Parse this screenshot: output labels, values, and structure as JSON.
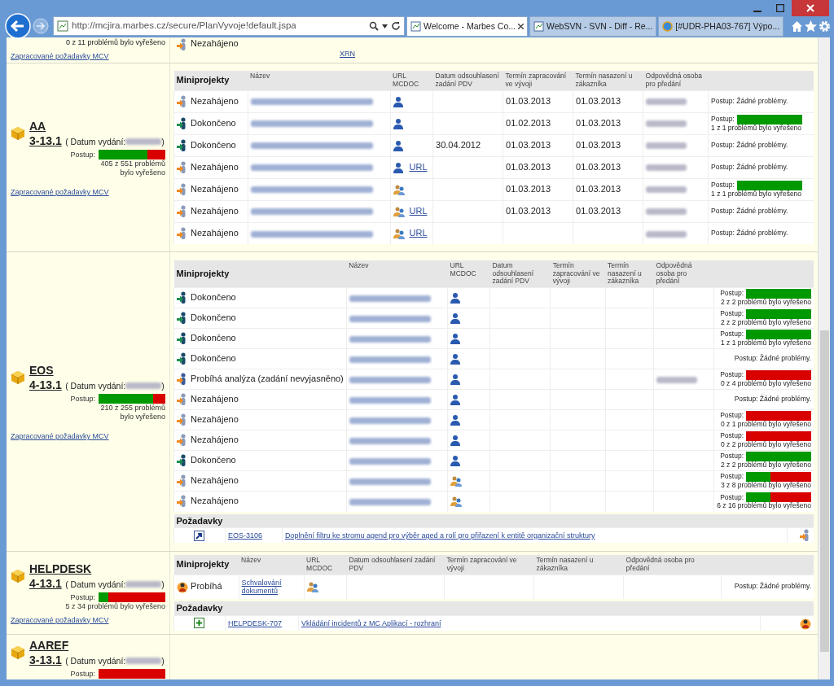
{
  "browser": {
    "address": "http://mcjira.marbes.cz/secure/PlanVyvoje!default.jspa",
    "tabs": [
      {
        "label": "Welcome - Marbes Co...",
        "selected": true
      },
      {
        "label": "WebSVN - SVN - Diff - Re...",
        "selected": false
      },
      {
        "label": "[#UDR-PHA03-767] Výpo...",
        "selected": false
      }
    ]
  },
  "top_stub": {
    "progress_text": "0 z 11 problémů bylo vyřešeno",
    "link": "Zapracované požadavky MCV",
    "status": "Nezahájeno",
    "kind": "not_started",
    "url": "XRN"
  },
  "releases": [
    {
      "name": "AA",
      "version": "3-13.1",
      "date_label": "( Datum vydání:",
      "date_close": ")",
      "progress_label": "Postup:",
      "level": 0.735,
      "progress_text": "405 z 551 problémů bylo vyřešeno",
      "link": "Zapracované požadavky MCV",
      "table_title": "Miniprojekty",
      "columns": [
        "Název",
        "URL MCDOC",
        "Datum odsouhlasení zadání PDV",
        "Termín zapracování ve vývoji",
        "Termín nasazení u zákazníka",
        "Odpovědná osoba pro předání"
      ],
      "rows": [
        {
          "status": "Nezahájeno",
          "kind": "not_started",
          "url_icon": {
            "kind": "person"
          },
          "datum": "",
          "termin_vyvoj": "01.03.2013",
          "termin_nasazeni": "01.03.2013",
          "person_redacted": true,
          "progress_label": "Postup:",
          "progress_text": "Žádné problémy."
        },
        {
          "status": "Dokončeno",
          "kind": "done",
          "url_icon": {
            "kind": "person"
          },
          "datum": "",
          "termin_vyvoj": "01.02.2013",
          "termin_nasazeni": "01.03.2013",
          "person_redacted": true,
          "progress_label": "Postup:",
          "level": 1,
          "progress_text": "1 z 1 problémů bylo vyřešeno"
        },
        {
          "status": "Dokončeno",
          "kind": "done",
          "url_icon": {
            "kind": "person"
          },
          "datum": "30.04.2012",
          "termin_vyvoj": "01.03.2013",
          "termin_nasazeni": "01.03.2013",
          "person_redacted": true,
          "progress_label": "Postup:",
          "progress_text": "Žádné problémy."
        },
        {
          "status": "Nezahájeno",
          "kind": "not_started",
          "url_icon": {
            "kind": "person"
          },
          "url": "URL",
          "datum": "",
          "termin_vyvoj": "01.03.2013",
          "termin_nasazeni": "01.03.2013",
          "person_redacted": true,
          "progress_label": "Postup:",
          "progress_text": "Žádné problémy."
        },
        {
          "status": "Nezahájeno",
          "kind": "not_started",
          "url_icon": {
            "kind": "group"
          },
          "datum": "",
          "termin_vyvoj": "01.03.2013",
          "termin_nasazeni": "01.03.2013",
          "person_redacted": true,
          "progress_label": "Postup:",
          "level": 1,
          "progress_text": "1 z 1 problémů bylo vyřešeno"
        },
        {
          "status": "Nezahájeno",
          "kind": "not_started",
          "url_icon": {
            "kind": "group"
          },
          "url": "URL",
          "datum": "",
          "termin_vyvoj": "01.03.2013",
          "termin_nasazeni": "01.03.2013",
          "person_redacted": true,
          "progress_label": "Postup:",
          "progress_text": "Žádné problémy."
        },
        {
          "status": "Nezahájeno",
          "kind": "not_started",
          "url_icon": {
            "kind": "group"
          },
          "url": "URL",
          "datum": "",
          "termin_vyvoj": "",
          "termin_nasazeni": "",
          "person_redacted": true,
          "progress_label": "Postup:",
          "progress_text": "Žádné problémy."
        }
      ]
    },
    {
      "name": "EOS",
      "version": "4-13.1",
      "date_label": "( Datum vydání:",
      "date_close": ")",
      "progress_label": "Postup:",
      "level": 0.82,
      "progress_text": "210 z 255 problémů bylo vyřešeno",
      "link": "Zapracované požadavky MCV",
      "table_title": "Miniprojekty",
      "columns": [
        "Název",
        "URL MCDOC",
        "Datum odsouhlasení zadání PDV",
        "Termín zapracování ve vývoji",
        "Termín nasazení u zákazníka",
        "Odpovědná osoba pro předání"
      ],
      "rows": [
        {
          "status": "Dokončeno",
          "kind": "done",
          "url_icon": {
            "kind": "person"
          },
          "person_redacted": false,
          "progress_label": "Postup:",
          "level": 1,
          "progress_text": "2 z 2 problémů bylo vyřešeno"
        },
        {
          "status": "Dokončeno",
          "kind": "done",
          "url_icon": {
            "kind": "person"
          },
          "person_redacted": false,
          "progress_label": "Postup:",
          "level": 1,
          "progress_text": "2 z 2 problémů bylo vyřešeno"
        },
        {
          "status": "Dokončeno",
          "kind": "done",
          "url_icon": {
            "kind": "person"
          },
          "person_redacted": false,
          "progress_label": "Postup:",
          "level": 1,
          "progress_text": "1 z 1 problémů bylo vyřešeno"
        },
        {
          "status": "Dokončeno",
          "kind": "done",
          "url_icon": {
            "kind": "person"
          },
          "person_redacted": false,
          "progress_label": "Postup:",
          "progress_text": "Žádné problémy."
        },
        {
          "status": "Probíhá analýza (zadání nevyjasněno)",
          "kind": "analysis",
          "url_icon": {
            "kind": "person"
          },
          "person_redacted": true,
          "progress_label": "Postup:",
          "level": 0,
          "progress_text": "0 z 4 problémů bylo vyřešeno"
        },
        {
          "status": "Nezahájeno",
          "kind": "not_started",
          "url_icon": {
            "kind": "person"
          },
          "person_redacted": false,
          "progress_label": "Postup:",
          "progress_text": "Žádné problémy."
        },
        {
          "status": "Nezahájeno",
          "kind": "not_started",
          "url_icon": {
            "kind": "person"
          },
          "person_redacted": false,
          "progress_label": "Postup:",
          "level": 0,
          "progress_text": "0 z 1 problémů bylo vyřešeno"
        },
        {
          "status": "Nezahájeno",
          "kind": "not_started",
          "url_icon": {
            "kind": "person"
          },
          "person_redacted": false,
          "progress_label": "Postup:",
          "level": 0,
          "progress_text": "0 z 2 problémů bylo vyřešeno"
        },
        {
          "status": "Dokončeno",
          "kind": "done",
          "url_icon": {
            "kind": "person"
          },
          "person_redacted": false,
          "progress_label": "Postup:",
          "level": 1,
          "progress_text": "2 z 2 problémů bylo vyřešeno"
        },
        {
          "status": "Nezahájeno",
          "kind": "not_started",
          "url_icon": {
            "kind": "group"
          },
          "person_redacted": false,
          "progress_label": "Postup:",
          "level": 0.375,
          "progress_text": "3 z 8 problémů bylo vyřešeno"
        },
        {
          "status": "Nezahájeno",
          "kind": "not_started",
          "url_icon": {
            "kind": "group"
          },
          "person_redacted": false,
          "progress_label": "Postup:",
          "level": 0.375,
          "progress_text": "6 z 16 problémů bylo vyřešeno"
        }
      ],
      "requests_title": "Požadavky",
      "requests": [
        {
          "kind": "arrow",
          "key": "EOS-3106",
          "summary": "Doplnění filtru ke stromu agend pro výběr aged a rolí pro přiřazení k entitě organizační struktury",
          "assignee_icon": {
            "kind": "person_arrow"
          }
        }
      ]
    },
    {
      "name": "HELPDESK",
      "version": "4-13.1",
      "date_label": "( Datum vydání:",
      "date_close": ")",
      "progress_label": "Postup:",
      "level": 0.147,
      "progress_text": "5 z 34 problémů bylo vyřešeno",
      "link": "Zapracované požadavky MCV",
      "table_title": "Miniprojekty",
      "columns": [
        "Název",
        "URL MCDOC",
        "Datum odsouhlasení zadání PDV",
        "Termín zapracování ve vývoji",
        "Termín nasazení u zákazníka",
        "Odpovědná osoba pro předání"
      ],
      "rows": [
        {
          "status": "Probíhá",
          "kind": "in_progress",
          "name": "Schvalování dokumentů",
          "url_icon": {
            "kind": "group"
          },
          "person_redacted": false,
          "progress_label": "Postup:",
          "progress_text": "Žádné problémy."
        }
      ],
      "requests_title": "Požadavky",
      "requests": [
        {
          "kind": "plus",
          "key": "HELPDESK-707",
          "summary": "Vkládání incidentů z MC Aplikací - rozhraní",
          "assignee_icon": {
            "kind": "person"
          }
        }
      ]
    },
    {
      "name": "AAREF",
      "version": "3-13.1",
      "date_label": "( Datum vydání:",
      "date_close": ")",
      "progress_label": "Postup:",
      "level": 0
    }
  ]
}
